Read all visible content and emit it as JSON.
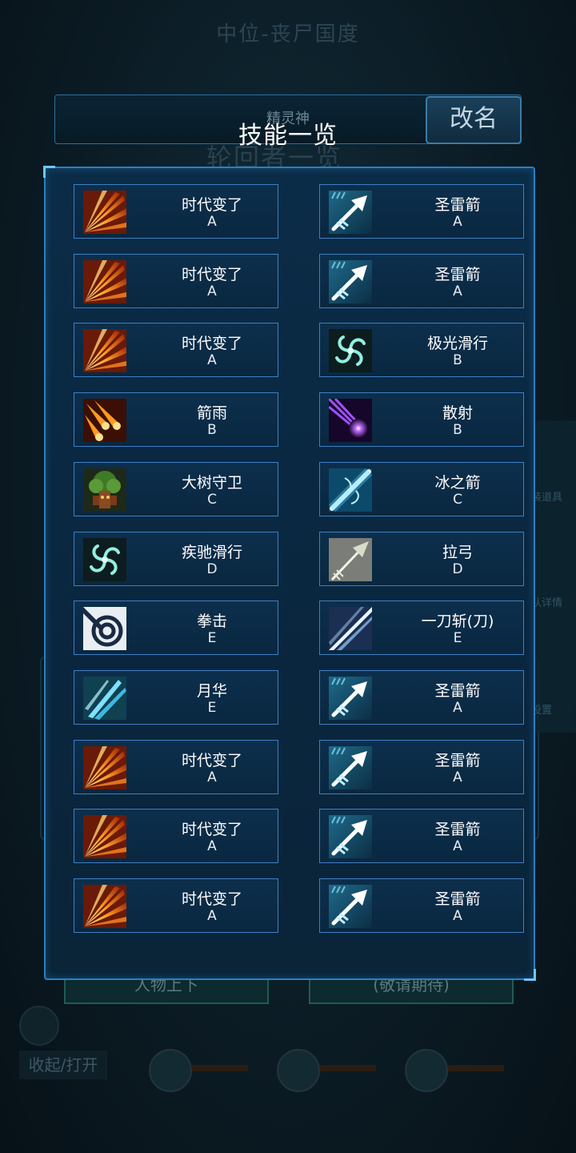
{
  "background": {
    "title": "中位-丧尸国度",
    "ghost_title": "轮回者一览",
    "side_labels": [
      "装道具",
      "队详情",
      "设置"
    ],
    "buttons": [
      "人物上下",
      "(敬请期待)"
    ],
    "toggle_label": "收起/打开"
  },
  "header": {
    "subtitle": "精灵神",
    "rename_label": "改名"
  },
  "modal": {
    "title": "技能一览"
  },
  "skills": {
    "left": [
      {
        "name": "时代变了",
        "grade": "A",
        "icon": "slash-icon"
      },
      {
        "name": "时代变了",
        "grade": "A",
        "icon": "slash-icon"
      },
      {
        "name": "时代变了",
        "grade": "A",
        "icon": "slash-icon"
      },
      {
        "name": "箭雨",
        "grade": "B",
        "icon": "arrow-rain-icon"
      },
      {
        "name": "大树守卫",
        "grade": "C",
        "icon": "tree-guard-icon"
      },
      {
        "name": "疾驰滑行",
        "grade": "D",
        "icon": "swirl-icon"
      },
      {
        "name": "拳击",
        "grade": "E",
        "icon": "punch-icon"
      },
      {
        "name": "月华",
        "grade": "E",
        "icon": "moon-blade-icon"
      },
      {
        "name": "时代变了",
        "grade": "A",
        "icon": "slash-icon"
      },
      {
        "name": "时代变了",
        "grade": "A",
        "icon": "slash-icon"
      },
      {
        "name": "时代变了",
        "grade": "A",
        "icon": "slash-icon"
      }
    ],
    "right": [
      {
        "name": "圣雷箭",
        "grade": "A",
        "icon": "thunder-arrow-icon"
      },
      {
        "name": "圣雷箭",
        "grade": "A",
        "icon": "thunder-arrow-icon"
      },
      {
        "name": "极光滑行",
        "grade": "B",
        "icon": "swirl-icon"
      },
      {
        "name": "散射",
        "grade": "B",
        "icon": "scatter-icon"
      },
      {
        "name": "冰之箭",
        "grade": "C",
        "icon": "ice-arrow-icon"
      },
      {
        "name": "拉弓",
        "grade": "D",
        "icon": "bow-draw-icon"
      },
      {
        "name": "一刀斩(刀)",
        "grade": "E",
        "icon": "blade-slash-icon"
      },
      {
        "name": "圣雷箭",
        "grade": "A",
        "icon": "thunder-arrow-icon"
      },
      {
        "name": "圣雷箭",
        "grade": "A",
        "icon": "thunder-arrow-icon"
      },
      {
        "name": "圣雷箭",
        "grade": "A",
        "icon": "thunder-arrow-icon"
      },
      {
        "name": "圣雷箭",
        "grade": "A",
        "icon": "thunder-arrow-icon"
      }
    ]
  },
  "colors": {
    "panel_border": "#2c7fc0",
    "card_border": "#3d7fc4",
    "panel_fill": "#0a2740"
  }
}
